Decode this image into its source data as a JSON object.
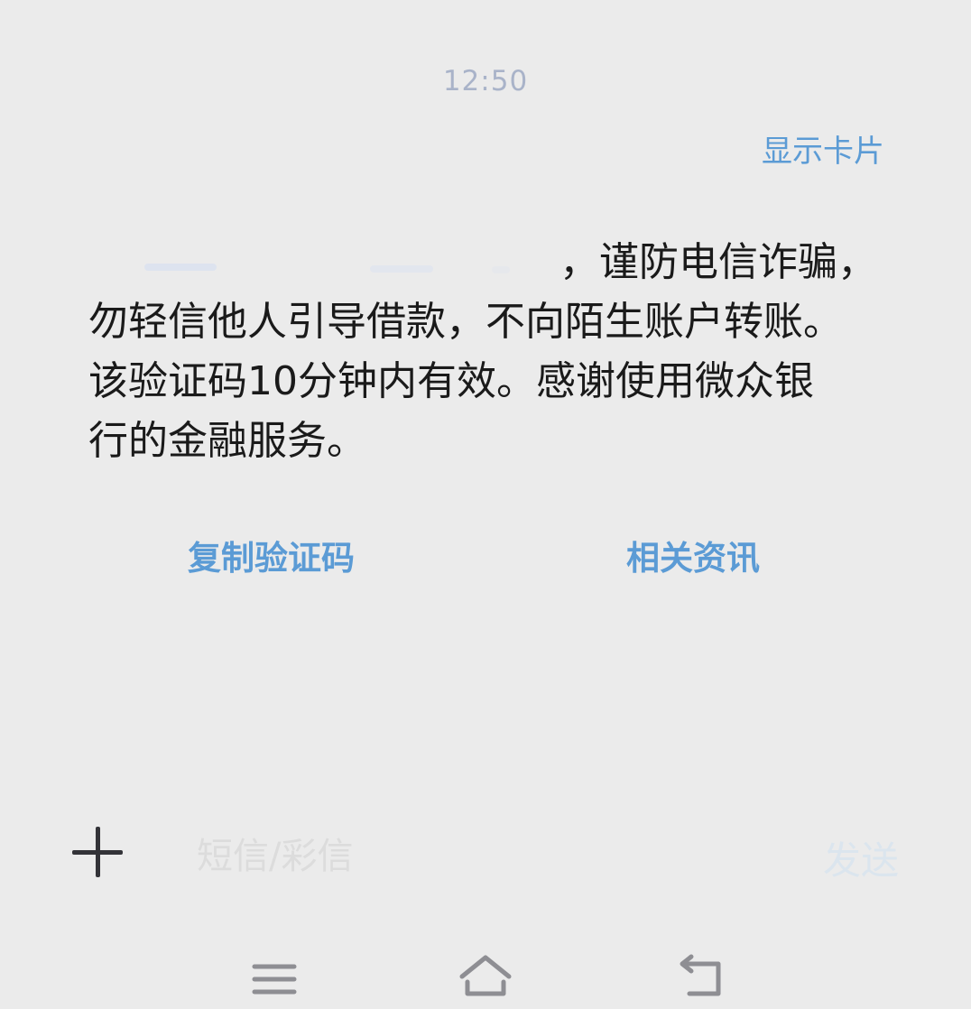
{
  "status": {
    "time": "12:50"
  },
  "header": {
    "show_card_label": "显示卡片"
  },
  "message": {
    "lines": [
      "，谨防电信诈骗，",
      "勿轻信他人引导借款，不向陌生账户转账。",
      "该验证码10分钟内有效。感谢使用微众银",
      "行的金融服务。"
    ]
  },
  "actions": {
    "copy_code_label": "复制验证码",
    "related_info_label": "相关资讯"
  },
  "composer": {
    "placeholder": "短信/彩信",
    "send_label": "发送",
    "attach_icon": "plus-icon"
  },
  "navbar": {
    "icons": [
      "menu-icon",
      "home-icon",
      "back-icon"
    ]
  },
  "colors": {
    "accent": "#5b9bd5",
    "background": "#ebebeb",
    "text": "#1a1a1a",
    "time": "#a9b3c9"
  }
}
